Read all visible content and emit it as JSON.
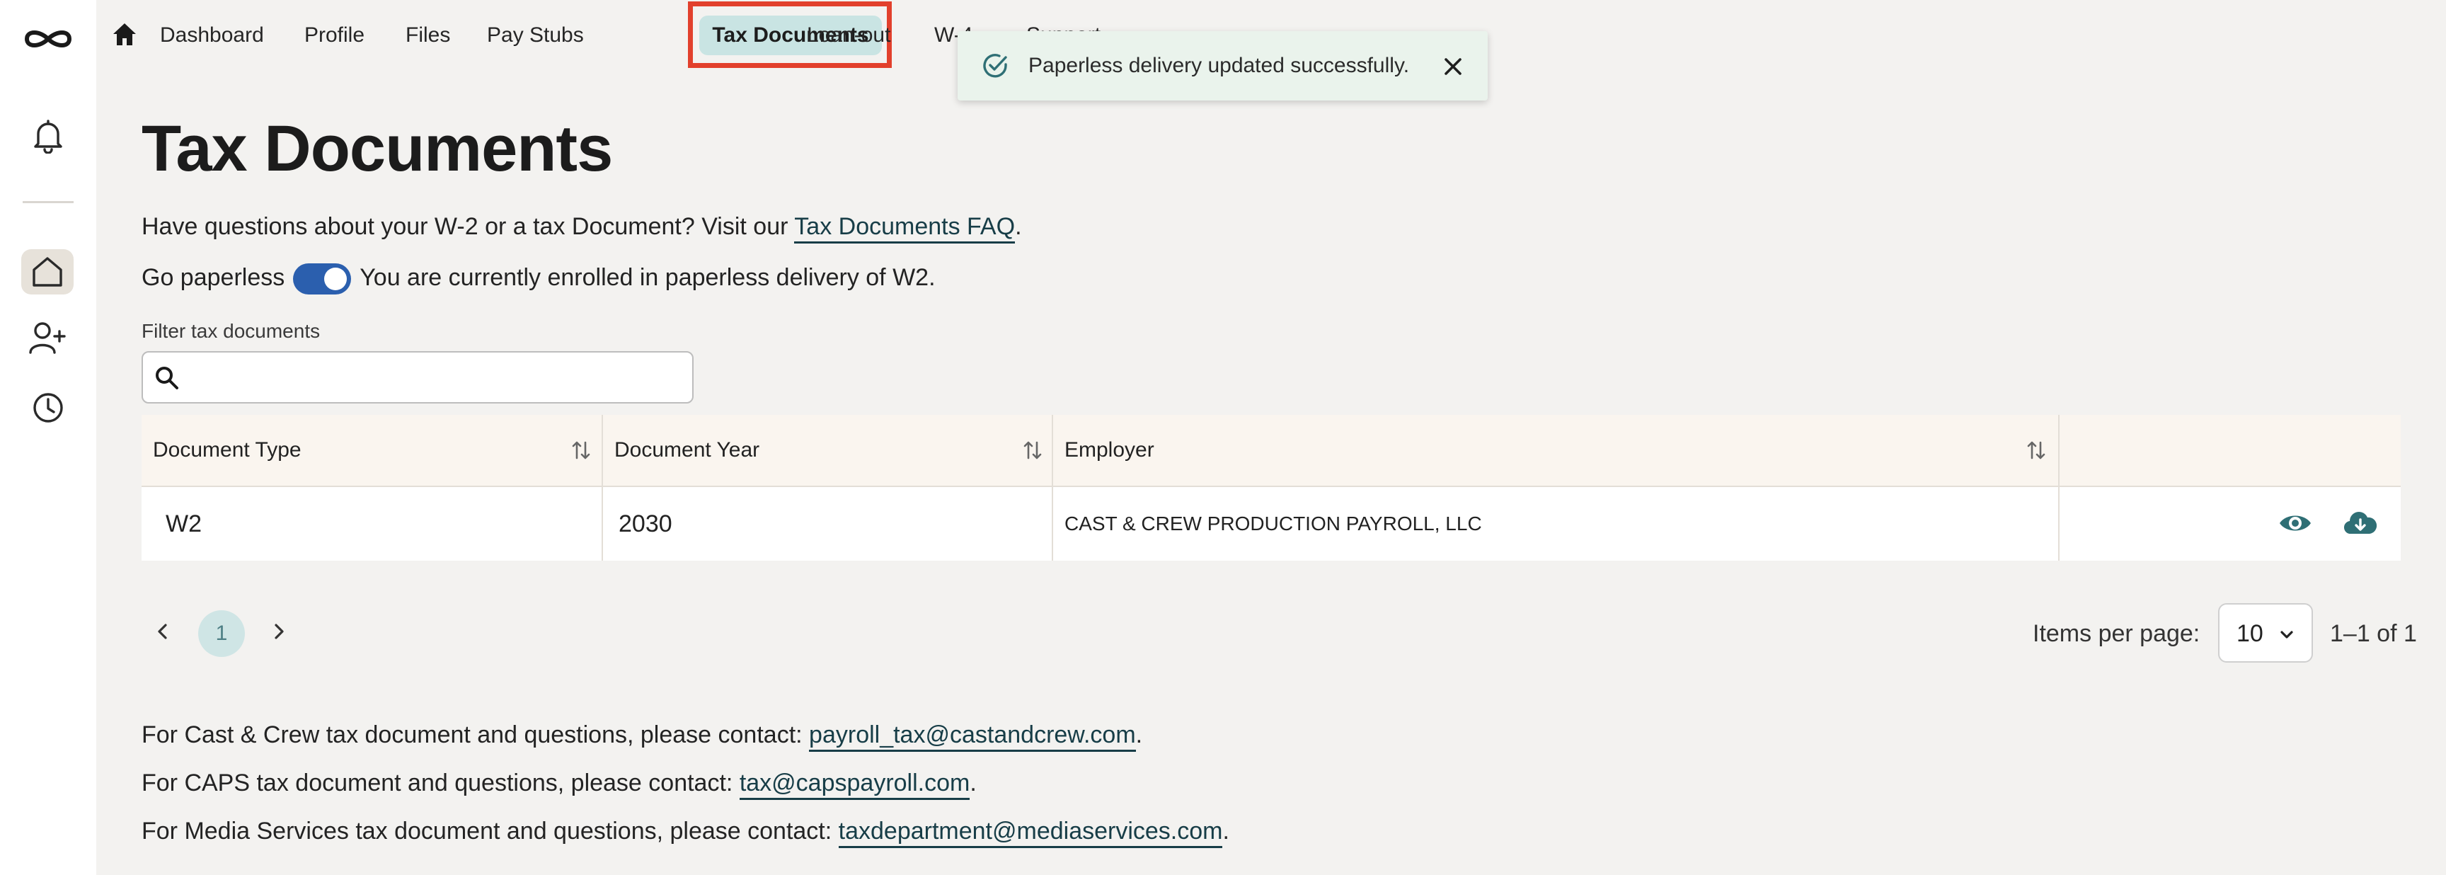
{
  "nav": {
    "items": [
      "Dashboard",
      "Profile",
      "Files",
      "Pay Stubs",
      "Tax Documents",
      "Loan-out",
      "W-4",
      "Support"
    ],
    "active": "Tax Documents"
  },
  "toast": {
    "message": "Paperless delivery updated successfully.",
    "color": "#eaf3ec"
  },
  "page": {
    "title": "Tax Documents",
    "faq_prefix": "Have questions about your W-2 or a tax Document? Visit our ",
    "faq_link": "Tax Documents FAQ",
    "faq_suffix": ".",
    "paperless_label": "Go paperless",
    "paperless_enabled": true,
    "paperless_status": "You are currently enrolled in paperless delivery of W2."
  },
  "filter": {
    "label": "Filter tax documents",
    "value": ""
  },
  "table": {
    "columns": [
      "Document Type",
      "Document Year",
      "Employer"
    ],
    "rows": [
      {
        "type": "W2",
        "year": "2030",
        "employer": "CAST & CREW PRODUCTION PAYROLL, LLC"
      }
    ]
  },
  "pagination": {
    "current_page": "1",
    "items_per_page_label": "Items per page:",
    "items_per_page": "10",
    "range": "1–1 of 1"
  },
  "contacts": [
    {
      "prefix": "For Cast & Crew tax document and questions, please contact: ",
      "email": "payroll_tax@castandcrew.com",
      "suffix": "."
    },
    {
      "prefix": "For CAPS tax document and questions, please contact: ",
      "email": "tax@capspayroll.com",
      "suffix": "."
    },
    {
      "prefix": "For Media Services tax document and questions, please contact: ",
      "email": "taxdepartment@mediaservices.com",
      "suffix": "."
    }
  ],
  "colors": {
    "accent_teal": "#2f6f75",
    "active_tab_frame": "#e2402c",
    "toggle_on": "#2b5fae"
  }
}
